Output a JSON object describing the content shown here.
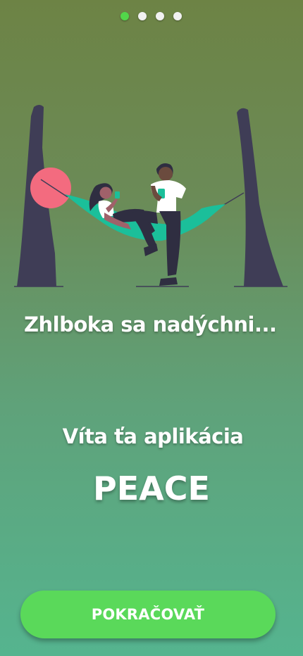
{
  "pager": {
    "total": 4,
    "active_index": 0
  },
  "illustration": {
    "icon": "hammock-relax-illustration"
  },
  "headline": "Zhlboka sa nadýchni...",
  "welcome": "Víta ťa aplikácia",
  "app_name": "PEACE",
  "continue_button": {
    "label": "POKRAČOVAŤ"
  },
  "colors": {
    "background_top": "#6d8345",
    "background_bottom": "#55b48f",
    "accent_green": "#5ad95a",
    "active_dot": "#52d64a",
    "hammock": "#1bbf9a",
    "sun": "#f36b7f",
    "tree": "#3f3d56"
  }
}
